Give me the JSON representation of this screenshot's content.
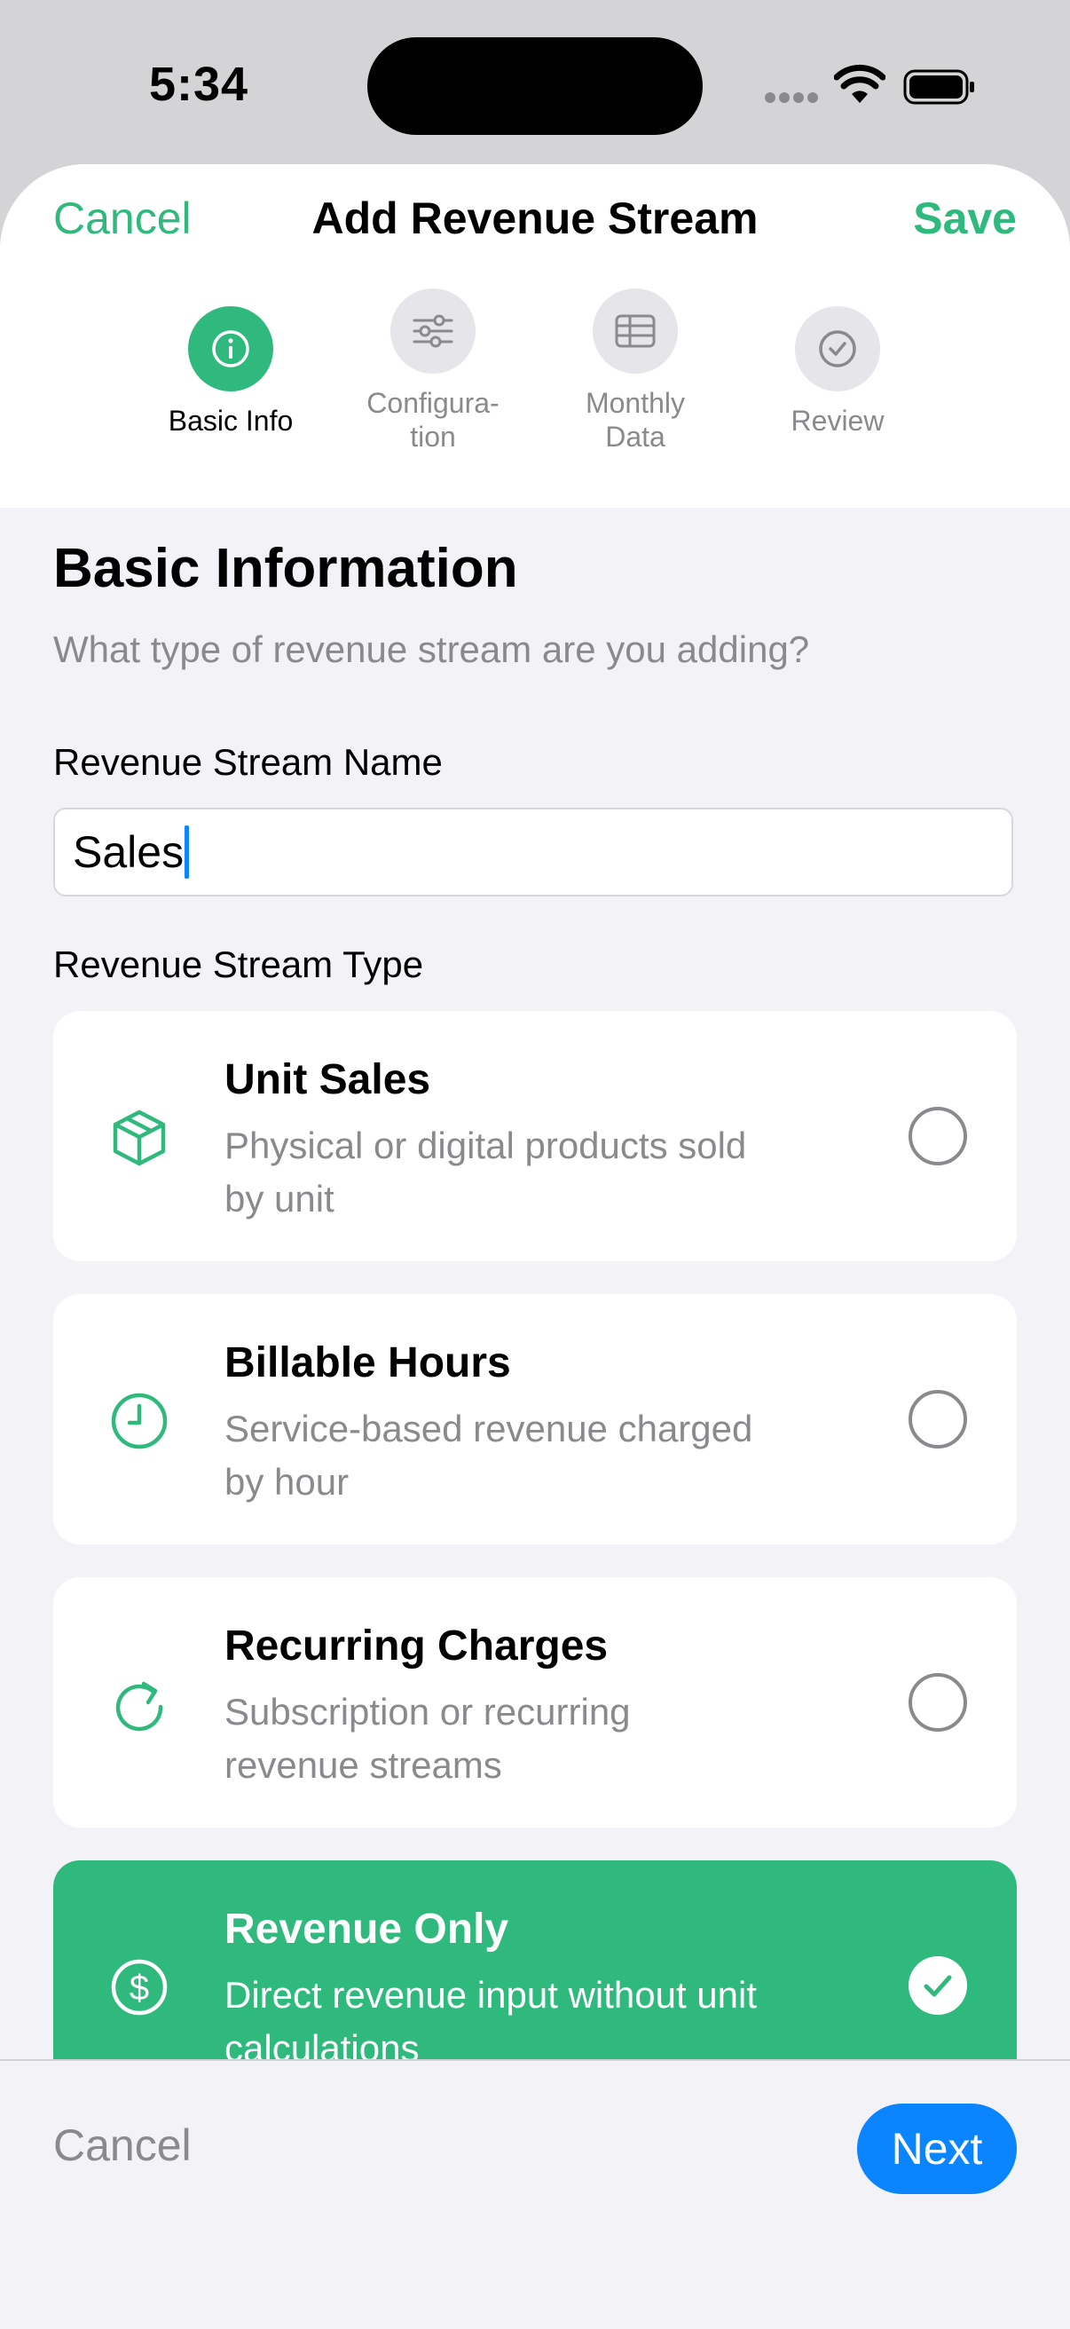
{
  "status_bar": {
    "time": "5:34"
  },
  "header": {
    "cancel_label": "Cancel",
    "title": "Add Revenue Stream",
    "save_label": "Save"
  },
  "steps": [
    {
      "label": "Basic Info",
      "icon": "info-icon",
      "active": true
    },
    {
      "label": "Configura-\ntion",
      "icon": "sliders-icon",
      "active": false
    },
    {
      "label": "Monthly\nData",
      "icon": "table-icon",
      "active": false
    },
    {
      "label": "Review",
      "icon": "checkmark-circle-icon",
      "active": false
    }
  ],
  "section": {
    "title": "Basic Information",
    "subtitle": "What type of revenue stream are you adding?"
  },
  "name_field": {
    "label": "Revenue Stream Name",
    "value": "Sales"
  },
  "type_field": {
    "label": "Revenue Stream Type",
    "options": [
      {
        "title": "Unit Sales",
        "description": "Physical or digital products sold by unit",
        "icon": "box-icon",
        "selected": false
      },
      {
        "title": "Billable Hours",
        "description": "Service-based revenue charged by hour",
        "icon": "clock-icon",
        "selected": false
      },
      {
        "title": "Recurring Charges",
        "description": "Subscription or recurring revenue streams",
        "icon": "refresh-icon",
        "selected": false
      },
      {
        "title": "Revenue Only",
        "description": "Direct revenue input without unit calculations",
        "icon": "dollar-circle-icon",
        "selected": true
      }
    ]
  },
  "footer": {
    "cancel_label": "Cancel",
    "next_label": "Next"
  },
  "colors": {
    "accent": "#2fb97c",
    "primary_button": "#0a84ff",
    "muted_text": "#8a8a8e",
    "background": "#f2f2f7"
  }
}
